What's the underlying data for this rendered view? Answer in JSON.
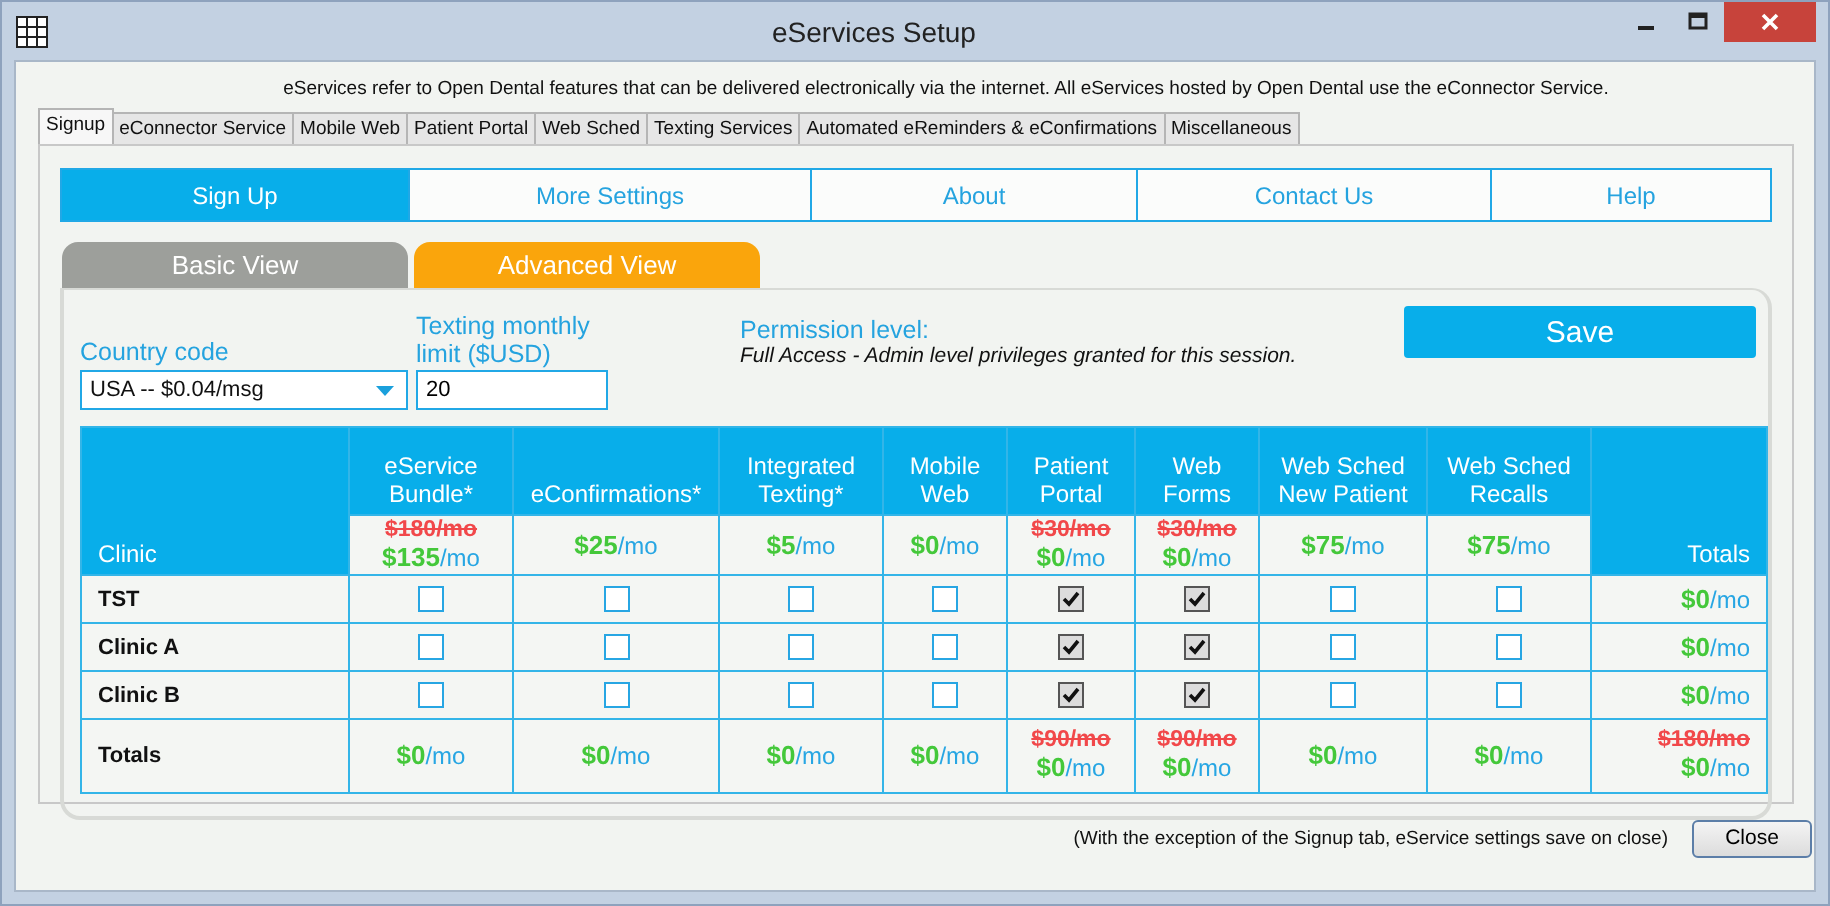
{
  "window": {
    "title": "eServices Setup"
  },
  "intro": "eServices refer to Open Dental features that can be delivered electronically via the internet.  All eServices hosted by Open Dental use the eConnector Service.",
  "tabs": [
    {
      "label": "Signup",
      "selected": true
    },
    {
      "label": "eConnector Service",
      "selected": false
    },
    {
      "label": "Mobile Web",
      "selected": false
    },
    {
      "label": "Patient Portal",
      "selected": false
    },
    {
      "label": "Web Sched",
      "selected": false
    },
    {
      "label": "Texting Services",
      "selected": false
    },
    {
      "label": "Automated eReminders & eConfirmations",
      "selected": false
    },
    {
      "label": "Miscellaneous",
      "selected": false
    }
  ],
  "nav": [
    {
      "label": "Sign Up",
      "selected": true
    },
    {
      "label": "More Settings",
      "selected": false
    },
    {
      "label": "About",
      "selected": false
    },
    {
      "label": "Contact Us",
      "selected": false
    },
    {
      "label": "Help",
      "selected": false
    }
  ],
  "views": [
    {
      "label": "Basic View",
      "selected": false
    },
    {
      "label": "Advanced View",
      "selected": true
    }
  ],
  "country_code": {
    "label": "Country code",
    "value": "USA -- $0.04/msg"
  },
  "texting_limit": {
    "label": "Texting monthly limit ($USD)",
    "value": "20"
  },
  "permission": {
    "label": "Permission level:",
    "text": "Full Access - Admin level privileges granted for this session."
  },
  "save_button": "Save",
  "table": {
    "clinic_header": "Clinic",
    "totals_header": "Totals",
    "services": [
      {
        "name": "eService Bundle*",
        "price": {
          "old": "$180/mo",
          "amount": "$135",
          "unit": "/mo"
        }
      },
      {
        "name": "eConfirmations*",
        "price": {
          "amount": "$25",
          "unit": "/mo"
        }
      },
      {
        "name": "Integrated Texting*",
        "price": {
          "amount": "$5",
          "unit": "/mo"
        }
      },
      {
        "name": "Mobile Web",
        "price": {
          "amount": "$0",
          "unit": "/mo"
        }
      },
      {
        "name": "Patient Portal",
        "price": {
          "old": "$30/mo",
          "amount": "$0",
          "unit": "/mo"
        }
      },
      {
        "name": "Web Forms",
        "price": {
          "old": "$30/mo",
          "amount": "$0",
          "unit": "/mo"
        }
      },
      {
        "name": "Web Sched New Patient",
        "price": {
          "amount": "$75",
          "unit": "/mo"
        }
      },
      {
        "name": "Web Sched Recalls",
        "price": {
          "amount": "$75",
          "unit": "/mo"
        }
      }
    ],
    "rows": [
      {
        "clinic": "TST",
        "checks": [
          false,
          false,
          false,
          false,
          true,
          true,
          false,
          false
        ],
        "total": {
          "amount": "$0",
          "unit": "/mo"
        }
      },
      {
        "clinic": "Clinic A",
        "checks": [
          false,
          false,
          false,
          false,
          true,
          true,
          false,
          false
        ],
        "total": {
          "amount": "$0",
          "unit": "/mo"
        }
      },
      {
        "clinic": "Clinic B",
        "checks": [
          false,
          false,
          false,
          false,
          true,
          true,
          false,
          false
        ],
        "total": {
          "amount": "$0",
          "unit": "/mo"
        }
      }
    ],
    "totals_row": {
      "label": "Totals",
      "values": [
        {
          "amount": "$0",
          "unit": "/mo"
        },
        {
          "amount": "$0",
          "unit": "/mo"
        },
        {
          "amount": "$0",
          "unit": "/mo"
        },
        {
          "amount": "$0",
          "unit": "/mo"
        },
        {
          "old": "$90/mo",
          "amount": "$0",
          "unit": "/mo"
        },
        {
          "old": "$90/mo",
          "amount": "$0",
          "unit": "/mo"
        },
        {
          "amount": "$0",
          "unit": "/mo"
        },
        {
          "amount": "$0",
          "unit": "/mo"
        }
      ],
      "grand_total": {
        "old": "$180/mo",
        "amount": "$0",
        "unit": "/mo"
      }
    }
  },
  "footer_note": "(With the exception of the Signup tab, eService settings save on close)",
  "close_button": "Close"
}
